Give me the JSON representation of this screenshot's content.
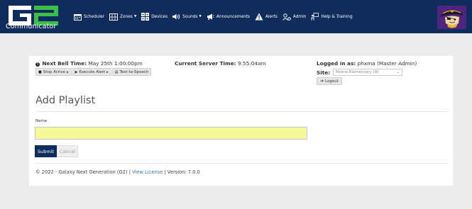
{
  "app": {
    "logo_text": "G2",
    "logo_subtitle": "Communicator"
  },
  "nav": {
    "items": [
      {
        "label": "Scheduler",
        "icon": "calendar-icon",
        "dropdown": false
      },
      {
        "label": "Zones",
        "icon": "grid-icon",
        "dropdown": true
      },
      {
        "label": "Devices",
        "icon": "devices-icon",
        "dropdown": false
      },
      {
        "label": "Sounds",
        "icon": "speaker-icon",
        "dropdown": true
      },
      {
        "label": "Announcements",
        "icon": "megaphone-icon",
        "dropdown": false
      },
      {
        "label": "Alerts",
        "icon": "warning-icon",
        "dropdown": false
      },
      {
        "label": "Admin",
        "icon": "users-cog-icon",
        "dropdown": false
      },
      {
        "label": "Help & Training",
        "icon": "help-person-icon",
        "dropdown": false
      }
    ]
  },
  "status": {
    "next_bell_label": "Next Bell Time:",
    "next_bell_value": "May 25th 1:00:00pm",
    "server_time_label": "Current Server Time:",
    "server_time_value": "9:55:04am",
    "buttons": [
      {
        "label": "Stop Active",
        "icon": "stop-icon"
      },
      {
        "label": "Execute Alert",
        "icon": "play-icon"
      },
      {
        "label": "Text-to-Speech",
        "icon": "keyboard-icon"
      }
    ]
  },
  "user": {
    "logged_in_label": "Logged in as:",
    "logged_in_value": "phxma (Master Admin)",
    "site_label": "Site:",
    "site_value": "Peoria Elementary (9)",
    "logout_label": "Logout"
  },
  "form": {
    "title": "Add Playlist",
    "name_label": "Name",
    "name_value": "",
    "submit_label": "Submit",
    "cancel_label": "Cancel"
  },
  "footer": {
    "copyright": "© 2022 - Galaxy Next Generation (G2) | ",
    "license_link": "View License",
    "version_text": " | Version: 7.0.0"
  },
  "colors": {
    "navbar": "#0f2d5c",
    "accent_green": "#3bbf4a",
    "input_highlight": "#f5f99a",
    "link": "#3a79b6",
    "mascot_bg": "#4f2580"
  }
}
